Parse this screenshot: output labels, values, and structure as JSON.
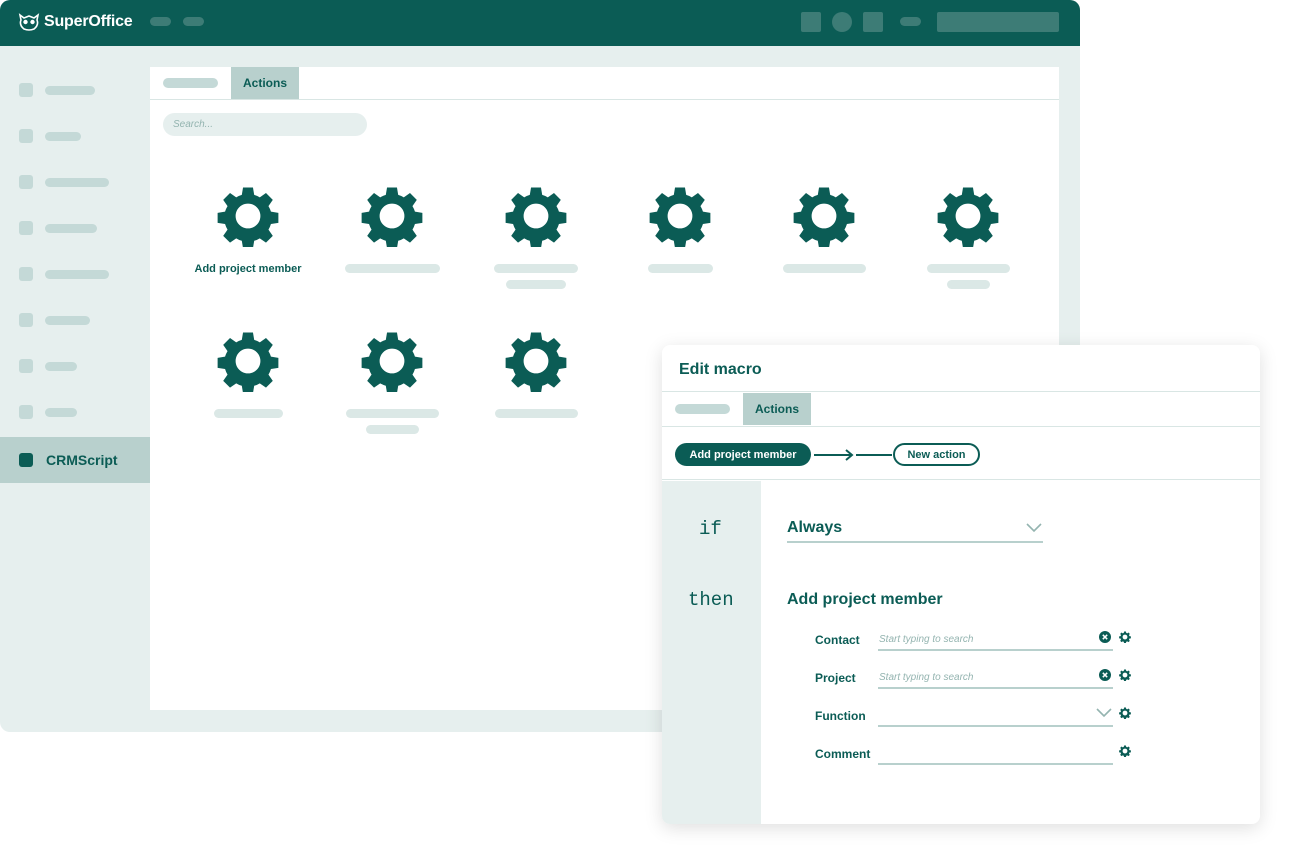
{
  "app": {
    "brand": "SuperOffice"
  },
  "colors": {
    "primary": "#0b5c55",
    "accent_light": "#b8d0cd",
    "background": "#e6efee"
  },
  "sidebar": {
    "active_item": "CRMScript"
  },
  "main": {
    "active_tab": "Actions",
    "search_placeholder": "Search...",
    "first_tile_label": "Add project member",
    "tile_icon": "gear-icon"
  },
  "dialog": {
    "title": "Edit macro",
    "active_tab": "Actions",
    "steps": [
      "Add project member",
      "New action"
    ],
    "if_keyword": "if",
    "then_keyword": "then",
    "condition": "Always",
    "action_title": "Add project member",
    "fields": [
      {
        "label": "Contact",
        "placeholder": "Start typing to search"
      },
      {
        "label": "Project",
        "placeholder": "Start typing to search"
      },
      {
        "label": "Function",
        "placeholder": ""
      },
      {
        "label": "Comment",
        "placeholder": ""
      }
    ]
  }
}
